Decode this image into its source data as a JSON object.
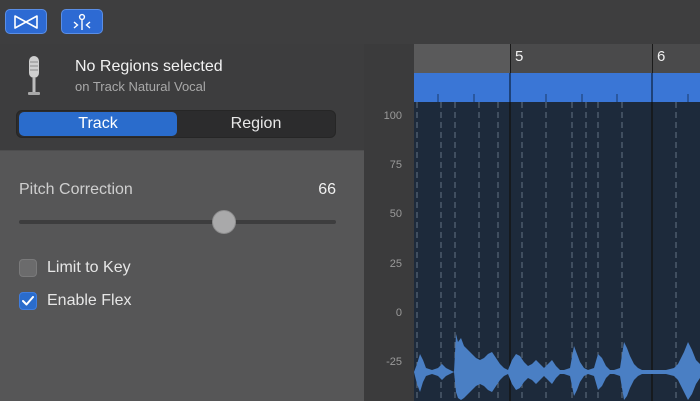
{
  "toolbar": {
    "buttons": [
      {
        "name": "bowtie-icon"
      },
      {
        "name": "flex-marker-icon"
      }
    ],
    "accent": "#2d6ad3"
  },
  "track": {
    "title": "No Regions selected",
    "subtitle": "on Track Natural Vocal"
  },
  "tabs": {
    "items": [
      "Track",
      "Region"
    ],
    "active": "Track"
  },
  "pitch_correction": {
    "label": "Pitch Correction",
    "value": "66",
    "level": 66
  },
  "options": {
    "limit_to_key": {
      "label": "Limit to Key",
      "checked": false
    },
    "enable_flex": {
      "label": "Enable Flex",
      "checked": true
    }
  },
  "ruler": {
    "bars": [
      "5",
      "6"
    ]
  },
  "y_axis": {
    "ticks": [
      "100",
      "75",
      "50",
      "25",
      "0",
      "-25"
    ]
  },
  "colors": {
    "region": "#3a76d6",
    "waveform": "#4a7fc4",
    "plot_bg": "#1d2a3b"
  }
}
